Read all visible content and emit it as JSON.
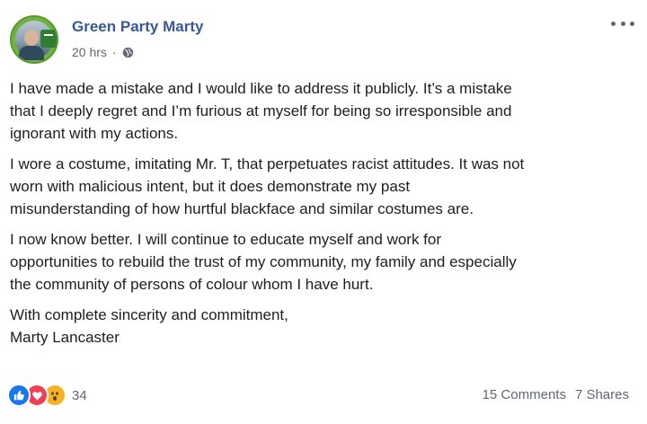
{
  "post": {
    "author": "Green Party Marty",
    "time": "20 hrs",
    "separator": "·",
    "paragraphs": [
      "I have made a mistake and I would like to address it publicly. It’s a mistake\nthat I deeply regret and I’m furious at myself for being so irresponsible and\nignorant with my actions.",
      "I wore a costume, imitating Mr. T, that perpetuates racist attitudes. It was not\nworn with malicious intent, but it does demonstrate my past\nmisunderstanding of how hurtful blackface and similar costumes are.",
      "I now know better. I will continue to educate myself and work for\nopportunities to rebuild the trust of my community, my family and especially\nthe community of persons of colour whom I have hurt.",
      "With complete sincerity and commitment,\nMarty Lancaster"
    ]
  },
  "reactions": {
    "icons": [
      "like-icon",
      "love-icon",
      "wow-icon"
    ],
    "count": "34"
  },
  "stats": {
    "comments": "15 Comments",
    "shares": "7 Shares"
  },
  "colors": {
    "author_link": "#385898",
    "meta_text": "#606770",
    "like": "#1877f2",
    "love": "#f33e58",
    "wow": "#f7b125"
  }
}
